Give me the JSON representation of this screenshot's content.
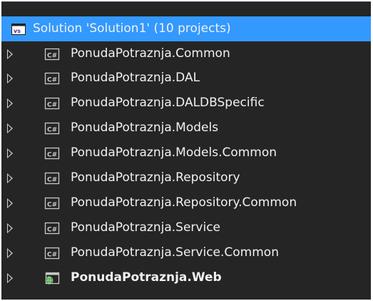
{
  "solution": {
    "label": "Solution 'Solution1' (10 projects)",
    "icon": "solution-icon"
  },
  "projects": [
    {
      "label": "PonudaPotraznja.Common",
      "icon": "csharp-project-icon"
    },
    {
      "label": "PonudaPotraznja.DAL",
      "icon": "csharp-project-icon"
    },
    {
      "label": "PonudaPotraznja.DALDBSpecific",
      "icon": "csharp-project-icon"
    },
    {
      "label": "PonudaPotraznja.Models",
      "icon": "csharp-project-icon"
    },
    {
      "label": "PonudaPotraznja.Models.Common",
      "icon": "csharp-project-icon"
    },
    {
      "label": "PonudaPotraznja.Repository",
      "icon": "csharp-project-icon"
    },
    {
      "label": "PonudaPotraznja.Repository.Common",
      "icon": "csharp-project-icon"
    },
    {
      "label": "PonudaPotraznja.Service",
      "icon": "csharp-project-icon"
    },
    {
      "label": "PonudaPotraznja.Service.Common",
      "icon": "csharp-project-icon"
    },
    {
      "label": "PonudaPotraznja.Web",
      "icon": "web-project-icon",
      "bold": true
    }
  ],
  "colors": {
    "background": "#252526",
    "selection": "#3399ff",
    "text": "#f1f1f1"
  }
}
